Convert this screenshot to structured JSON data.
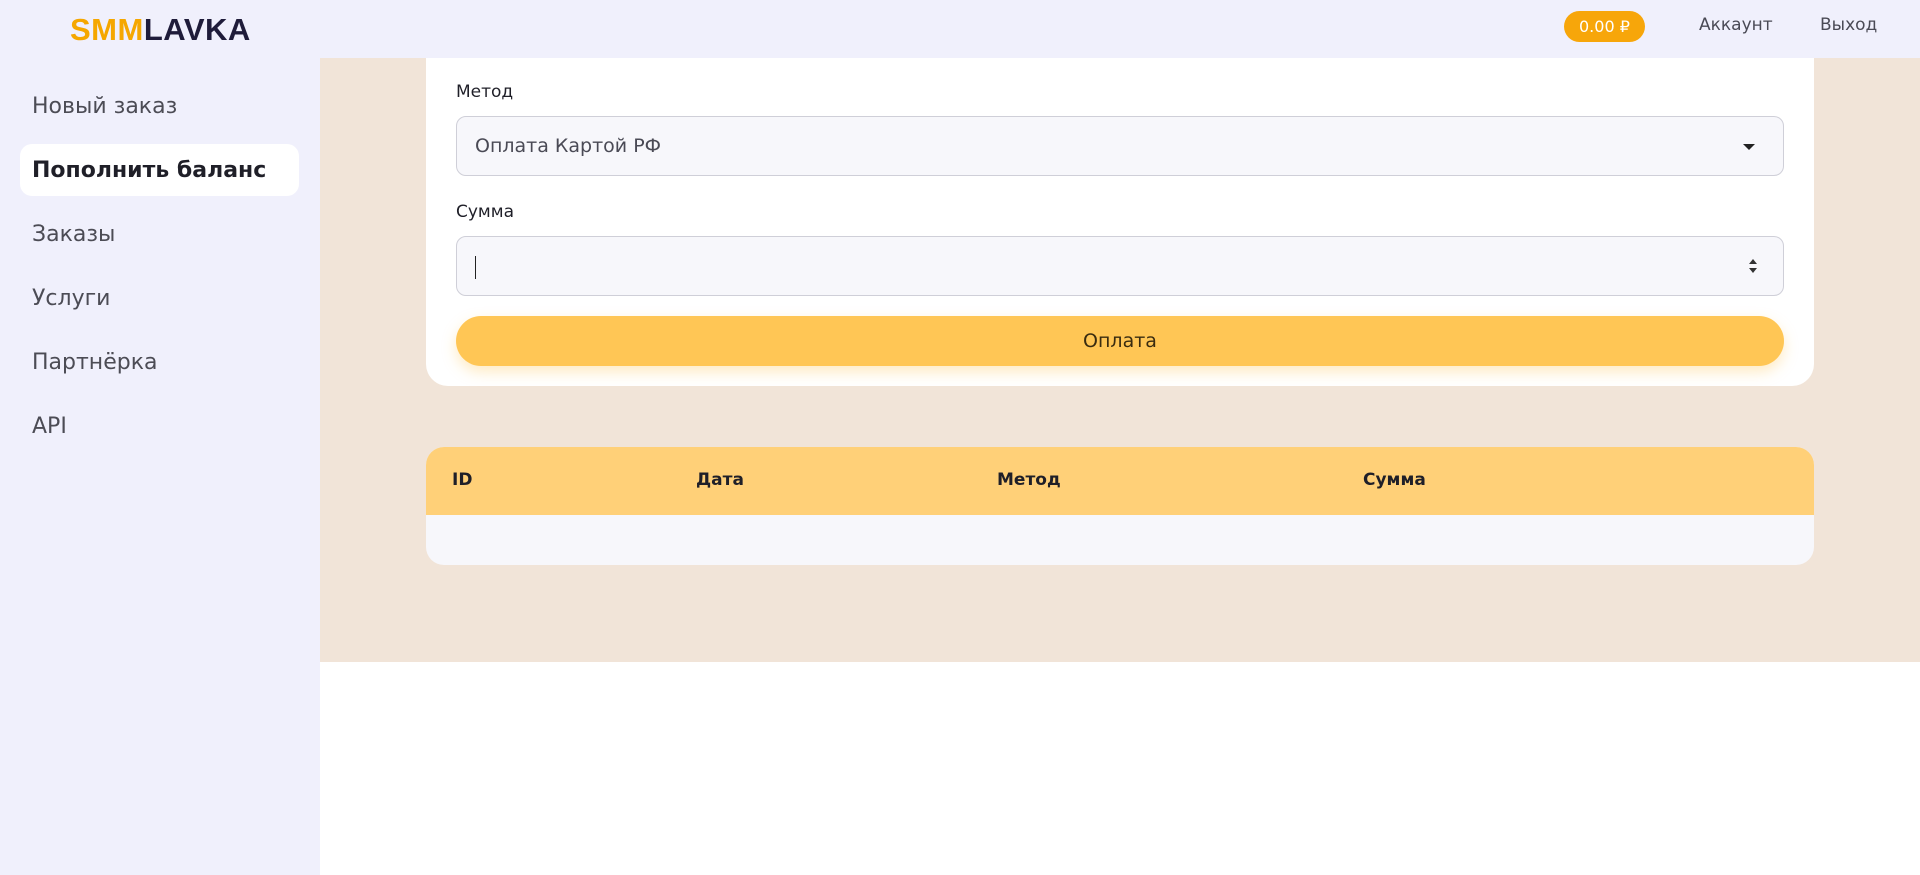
{
  "logo": {
    "part1": "SMM",
    "part2": "LAVKA"
  },
  "sidebar": {
    "items": [
      {
        "label": "Новый заказ"
      },
      {
        "label": "Пополнить баланс"
      },
      {
        "label": "Заказы"
      },
      {
        "label": "Услуги"
      },
      {
        "label": "Партнёрка"
      },
      {
        "label": "API"
      }
    ]
  },
  "header": {
    "balance": "0.00 ₽",
    "account_label": "Аккаунт",
    "logout_label": "Выход"
  },
  "form": {
    "method_label": "Метод",
    "method_value": "Оплата Картой РФ",
    "amount_label": "Сумма",
    "amount_value": "",
    "submit_label": "Оплата"
  },
  "table": {
    "headers": [
      "ID",
      "Дата",
      "Метод",
      "Сумма"
    ],
    "rows": []
  },
  "colors": {
    "accent": "#f7a60a",
    "button": "#ffc655",
    "table_header": "#ffd078",
    "sidebar_bg": "#f0f0fc",
    "content_bg": "#f1e4d8"
  }
}
